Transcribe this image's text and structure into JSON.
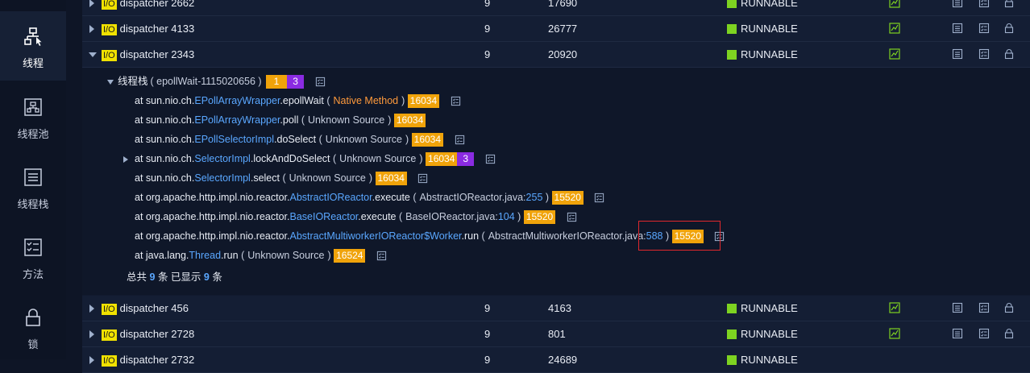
{
  "sidebar": {
    "items": [
      {
        "label": "线程",
        "icon": "thread-icon",
        "active": true
      },
      {
        "label": "线程池",
        "icon": "thread-pool-icon",
        "active": false
      },
      {
        "label": "线程栈",
        "icon": "thread-stack-icon",
        "active": false
      },
      {
        "label": "方法",
        "icon": "method-icon",
        "active": false
      },
      {
        "label": "锁",
        "icon": "lock-icon",
        "active": false
      }
    ]
  },
  "rows": [
    {
      "tag": "I/O",
      "name": "dispatcher 2662",
      "priority": "9",
      "tid": "17690",
      "state": "RUNNABLE"
    },
    {
      "tag": "I/O",
      "name": "dispatcher 4133",
      "priority": "9",
      "tid": "26777",
      "state": "RUNNABLE"
    },
    {
      "tag": "I/O",
      "name": "dispatcher 2343",
      "priority": "9",
      "tid": "20920",
      "state": "RUNNABLE"
    },
    {
      "tag": "I/O",
      "name": "dispatcher 456",
      "priority": "9",
      "tid": "4163",
      "state": "RUNNABLE"
    },
    {
      "tag": "I/O",
      "name": "dispatcher 2728",
      "priority": "9",
      "tid": "801",
      "state": "RUNNABLE"
    },
    {
      "tag": "I/O",
      "name": "dispatcher 2732",
      "priority": "9",
      "tid": "24689",
      "state": "RUNNABLE"
    }
  ],
  "stack": {
    "header_label": "线程栈",
    "header_paren": "( epollWait-1115020656 )",
    "badge_orange": "1",
    "badge_purple": "3",
    "frames": [
      {
        "prefix": "at sun.nio.ch.",
        "cls": "EPollArrayWrapper",
        "method": ".epollWait",
        "source": "Native Method",
        "line": "",
        "count": "16034",
        "extra": "",
        "native": true
      },
      {
        "prefix": "at sun.nio.ch.",
        "cls": "EPollArrayWrapper",
        "method": ".poll",
        "source": "Unknown Source",
        "line": "",
        "count": "16034",
        "extra": "",
        "native": false
      },
      {
        "prefix": "at sun.nio.ch.",
        "cls": "EPollSelectorImpl",
        "method": ".doSelect",
        "source": "Unknown Source",
        "line": "",
        "count": "16034",
        "extra": "",
        "native": false
      },
      {
        "prefix": "at sun.nio.ch.",
        "cls": "SelectorImpl",
        "method": ".lockAndDoSelect",
        "source": "Unknown Source",
        "line": "",
        "count": "16034",
        "extra": "3",
        "native": false
      },
      {
        "prefix": "at sun.nio.ch.",
        "cls": "SelectorImpl",
        "method": ".select",
        "source": "Unknown Source",
        "line": "",
        "count": "16034",
        "extra": "",
        "native": false
      },
      {
        "prefix": "at org.apache.http.impl.nio.reactor.",
        "cls": "AbstractIOReactor",
        "method": ".execute",
        "source": "AbstractIOReactor.java:",
        "line": "255",
        "count": "15520",
        "extra": "",
        "native": false
      },
      {
        "prefix": "at org.apache.http.impl.nio.reactor.",
        "cls": "BaseIOReactor",
        "method": ".execute",
        "source": "BaseIOReactor.java:",
        "line": "104",
        "count": "15520",
        "extra": "",
        "native": false
      },
      {
        "prefix": "at org.apache.http.impl.nio.reactor.",
        "cls": "AbstractMultiworkerIOReactor$Worker",
        "method": ".run",
        "source": "AbstractMultiworkerIOReactor.java:",
        "line": "588",
        "count": "15520",
        "extra": "",
        "native": false
      },
      {
        "prefix": "at java.lang.",
        "cls": "Thread",
        "method": ".run",
        "source": "Unknown Source",
        "line": "",
        "count": "16524",
        "extra": "",
        "native": false
      }
    ],
    "summary": {
      "t1": "总共",
      "total": "9",
      "t2": "条 已显示",
      "shown": "9",
      "t3": "条"
    }
  },
  "colors": {
    "runnable": "#7ed321",
    "io_badge": "#f0e100",
    "count_badge": "#f0a30a",
    "purple_badge": "#8a2be2",
    "highlight": "#e0282d",
    "class_link": "#5aa7ff"
  }
}
